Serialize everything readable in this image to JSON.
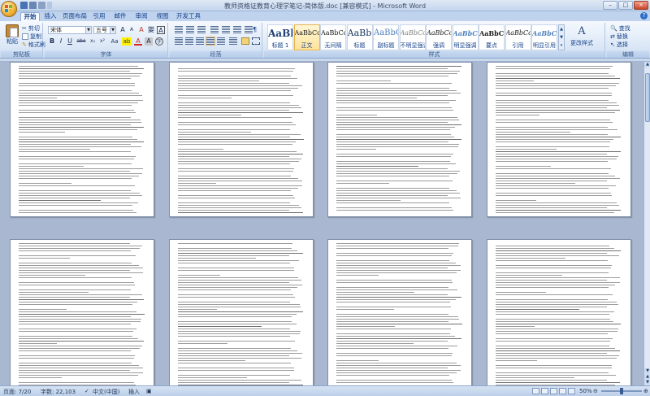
{
  "app": {
    "title": "教师资格证教育心理学笔记-简体版.doc [兼容模式] - Microsoft Word",
    "window_controls": [
      "–",
      "□",
      "×"
    ]
  },
  "tabs": [
    "开始",
    "插入",
    "页面布局",
    "引用",
    "邮件",
    "审阅",
    "视图",
    "开发工具"
  ],
  "active_tab": "开始",
  "ribbon": {
    "clipboard": {
      "label": "剪贴板",
      "paste": "粘贴",
      "cut": "剪切",
      "copy": "复制",
      "format_painter": "格式刷"
    },
    "font": {
      "label": "字体",
      "font_name": "宋体",
      "font_size": "五号",
      "grow": "A",
      "shrink": "A",
      "clear": "A",
      "phonetic": "變",
      "border_char": "A",
      "bold": "B",
      "italic": "I",
      "underline": "U",
      "strike": "abe",
      "subscript": "x₂",
      "superscript": "x²",
      "case": "Aa",
      "highlight": "ab",
      "font_color": "A",
      "char_shading": "A",
      "enclose": "字"
    },
    "paragraph": {
      "label": "段落"
    },
    "styles": {
      "label": "样式",
      "items": [
        {
          "sample": "AaBl",
          "name": "标题 1"
        },
        {
          "sample": "AaBbCcDc",
          "name": "正文"
        },
        {
          "sample": "AaBbCcDc",
          "name": "无间隔"
        },
        {
          "sample": "AaBb",
          "name": "标题"
        },
        {
          "sample": "AaBbC",
          "name": "副标题"
        },
        {
          "sample": "AaBbCcDc",
          "name": "不明显强调"
        },
        {
          "sample": "AaBbCcDc",
          "name": "强调"
        },
        {
          "sample": "AaBbCcDc",
          "name": "明显强调"
        },
        {
          "sample": "AaBbCcD",
          "name": "要点"
        },
        {
          "sample": "AaBbCcDc",
          "name": "引用"
        },
        {
          "sample": "AaBbCcD",
          "name": "明显引用"
        }
      ],
      "change_styles": "更改样式",
      "change_styles_sample": "A"
    },
    "editing": {
      "label": "编辑",
      "find": "查找",
      "replace": "替换",
      "select": "选择"
    }
  },
  "status": {
    "page": "页面: 7/20",
    "words": "字数: 22,103",
    "language": "中文(中国)",
    "mode": "插入",
    "zoom": "50%",
    "zoom_level": 0.5
  }
}
